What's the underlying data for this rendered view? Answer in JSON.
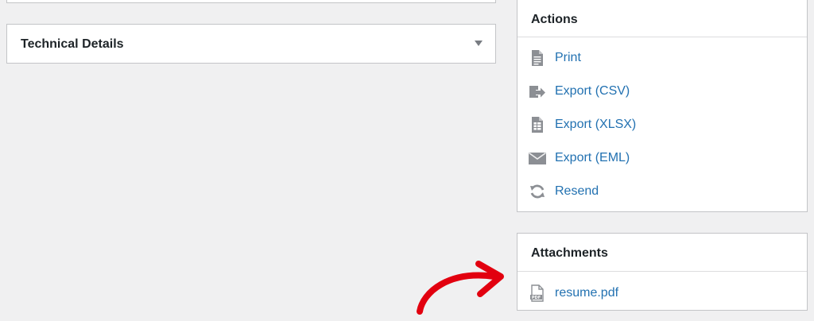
{
  "technical_details": {
    "title": "Technical Details"
  },
  "actions": {
    "title": "Actions",
    "items": [
      {
        "label": "Print",
        "icon": "document-icon"
      },
      {
        "label": "Export (CSV)",
        "icon": "export-icon"
      },
      {
        "label": "Export (XLSX)",
        "icon": "spreadsheet-icon"
      },
      {
        "label": "Export (EML)",
        "icon": "envelope-icon"
      },
      {
        "label": "Resend",
        "icon": "refresh-icon"
      }
    ]
  },
  "attachments": {
    "title": "Attachments",
    "items": [
      {
        "label": "resume.pdf",
        "icon": "pdf-file-icon",
        "icon_text": "PDF"
      }
    ]
  },
  "colors": {
    "background": "#f0f0f1",
    "link": "#2271b1",
    "icon": "#8c8f94",
    "annotation_arrow": "#e2000f"
  }
}
